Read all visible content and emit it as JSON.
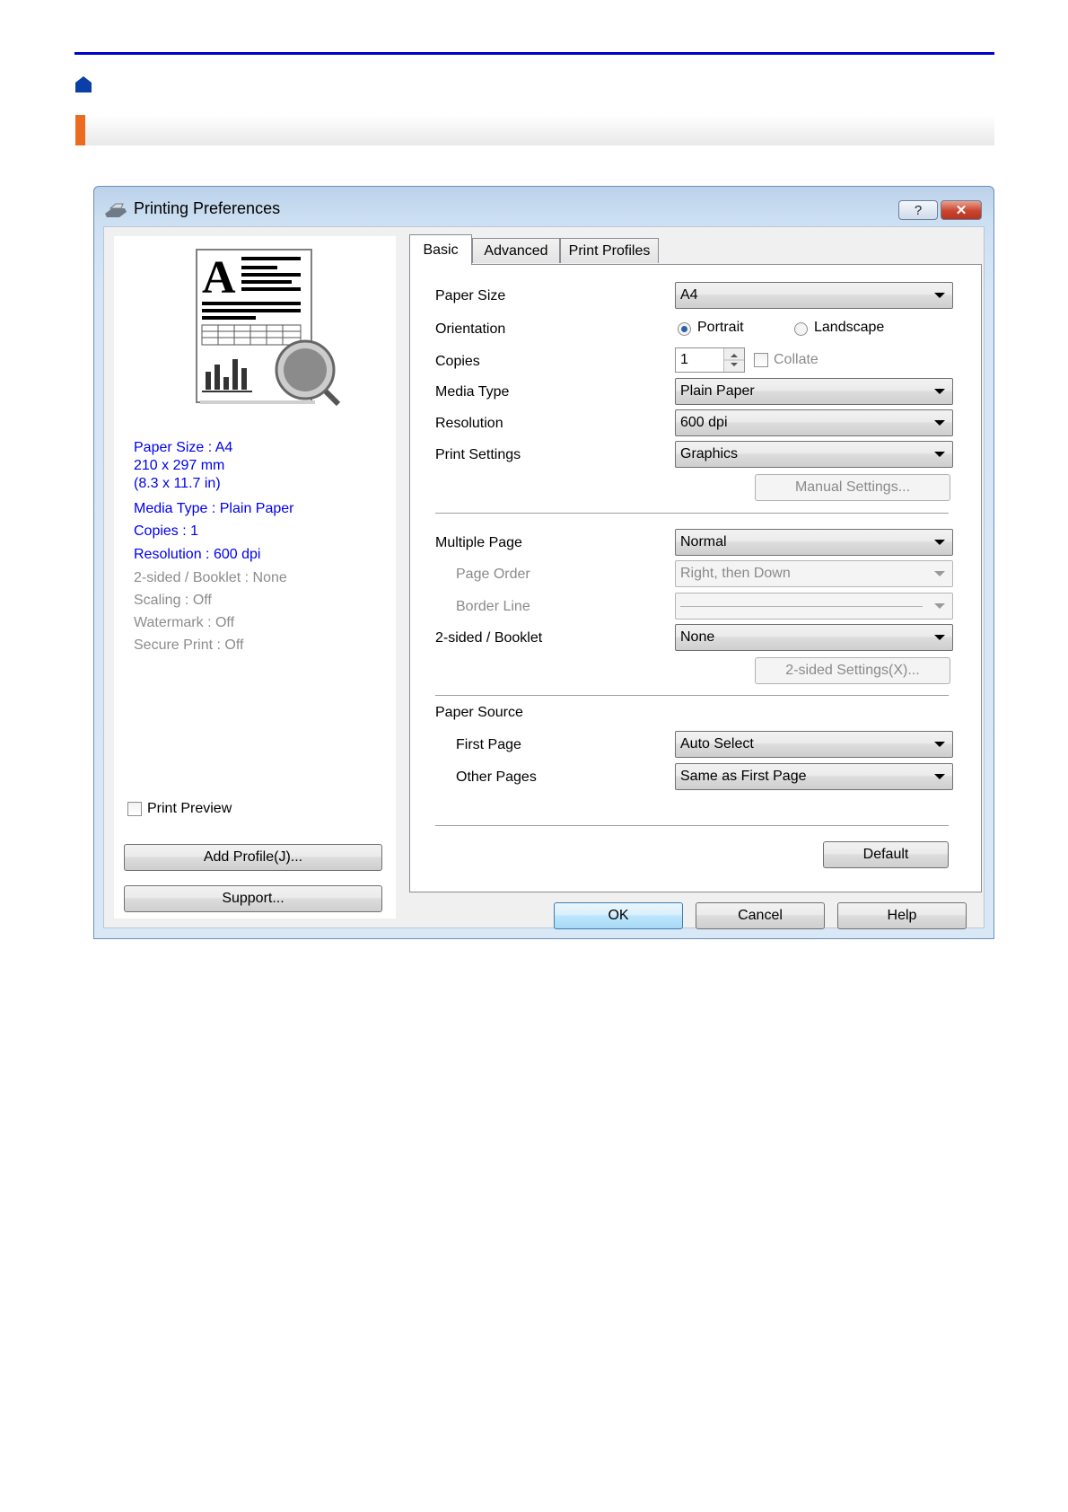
{
  "window": {
    "title": "Printing Preferences",
    "help_label": "?",
    "close_label": "✕"
  },
  "preview": {
    "glyph": "A"
  },
  "summary": {
    "paper_size": "Paper Size : A4",
    "paper_mm": "210 x 297 mm",
    "paper_in": "(8.3 x 11.7 in)",
    "media_type": "Media Type : Plain Paper",
    "copies": "Copies : 1",
    "resolution": "Resolution : 600 dpi",
    "two_sided": "2-sided / Booklet : None",
    "scaling": "Scaling : Off",
    "watermark": "Watermark : Off",
    "secure_print": "Secure Print : Off"
  },
  "left_controls": {
    "print_preview_label": "Print Preview",
    "add_profile_label": "Add Profile(J)...",
    "support_label": "Support..."
  },
  "tabs": [
    "Basic",
    "Advanced",
    "Print Profiles"
  ],
  "basic": {
    "paper_size_label": "Paper Size",
    "paper_size_value": "A4",
    "orientation_label": "Orientation",
    "portrait_label": "Portrait",
    "landscape_label": "Landscape",
    "copies_label": "Copies",
    "copies_value": "1",
    "collate_label": "Collate",
    "media_type_label": "Media Type",
    "media_type_value": "Plain Paper",
    "resolution_label": "Resolution",
    "resolution_value": "600 dpi",
    "print_settings_label": "Print Settings",
    "print_settings_value": "Graphics",
    "manual_settings_label": "Manual Settings...",
    "multiple_page_label": "Multiple Page",
    "multiple_page_value": "Normal",
    "page_order_label": "Page Order",
    "page_order_value": "Right, then Down",
    "border_line_label": "Border Line",
    "two_sided_label": "2-sided / Booklet",
    "two_sided_value": "None",
    "two_sided_settings_label": "2-sided Settings(X)...",
    "paper_source_label": "Paper Source",
    "first_page_label": "First Page",
    "first_page_value": "Auto Select",
    "other_pages_label": "Other Pages",
    "other_pages_value": "Same as First Page",
    "default_label": "Default"
  },
  "footer": {
    "ok_label": "OK",
    "cancel_label": "Cancel",
    "help_label": "Help"
  }
}
